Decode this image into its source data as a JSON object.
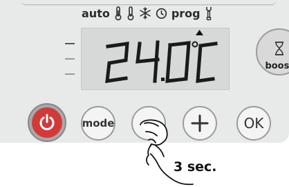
{
  "indicators": {
    "auto_label": "auto",
    "prog_label": "prog",
    "icons": [
      "comfort-thermometer-icon",
      "eco-thermometer-icon",
      "frost-snowflake-icon",
      "clock-icon",
      "program-wrench-icon"
    ]
  },
  "display": {
    "temperature": "24.0",
    "unit": "°C",
    "increase_indicator": "up-arrow"
  },
  "buttons": {
    "power_icon": "power-icon",
    "mode_label": "mode",
    "minus_icon": "minus-icon",
    "plus_icon": "plus-icon",
    "ok_label": "OK",
    "boost_label": "boost",
    "boost_icon": "hourglass-icon"
  },
  "instruction": {
    "hold_caption": "3 sec."
  },
  "colors": {
    "power_button": "#d23a3a",
    "panel": "#e8e9e9",
    "lcd": "#d7d8d8"
  }
}
